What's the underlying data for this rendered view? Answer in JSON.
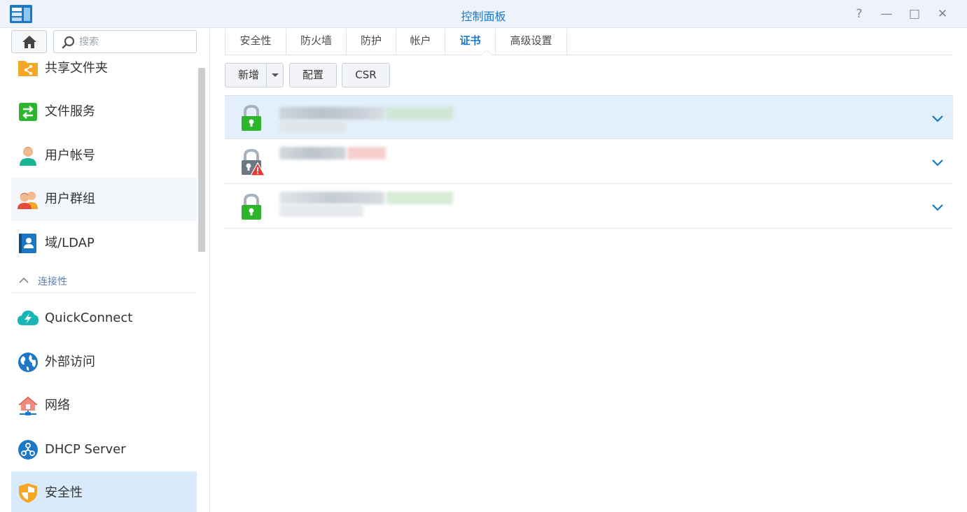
{
  "window": {
    "title": "控制面板",
    "controls": [
      "?",
      "—",
      "□",
      "✕"
    ]
  },
  "sidebar": {
    "search_placeholder": "搜索",
    "items": [
      {
        "label": "共享文件夹",
        "icon": "shared-folder-icon"
      },
      {
        "label": "文件服务",
        "icon": "file-services-icon"
      },
      {
        "label": "用户帐号",
        "icon": "user-icon"
      },
      {
        "label": "用户群组",
        "icon": "group-icon"
      },
      {
        "label": "域/LDAP",
        "icon": "ldap-icon"
      }
    ],
    "section_label": "连接性",
    "section_items": [
      {
        "label": "QuickConnect",
        "icon": "quickconnect-icon"
      },
      {
        "label": "外部访问",
        "icon": "globe-icon"
      },
      {
        "label": "网络",
        "icon": "network-icon"
      },
      {
        "label": "DHCP Server",
        "icon": "dhcp-icon"
      },
      {
        "label": "安全性",
        "icon": "shield-icon"
      }
    ]
  },
  "tabs": [
    "安全性",
    "防火墙",
    "防护",
    "帐户",
    "证书",
    "高级设置"
  ],
  "active_tab": "证书",
  "toolbar": {
    "add_label": "新增",
    "configure_label": "配置",
    "csr_label": "CSR"
  },
  "certificates": [
    {
      "status": "valid",
      "icon": "green-lock-icon",
      "selected": true
    },
    {
      "status": "warning",
      "icon": "lock-warning-icon",
      "selected": false
    },
    {
      "status": "valid",
      "icon": "green-lock-icon",
      "selected": false
    }
  ],
  "colors": {
    "accent": "#1c78c4",
    "selected_row": "#e3effb",
    "active_nav": "#d9ebfa",
    "lock_green": "#2db52d",
    "warning_red": "#e53935"
  }
}
